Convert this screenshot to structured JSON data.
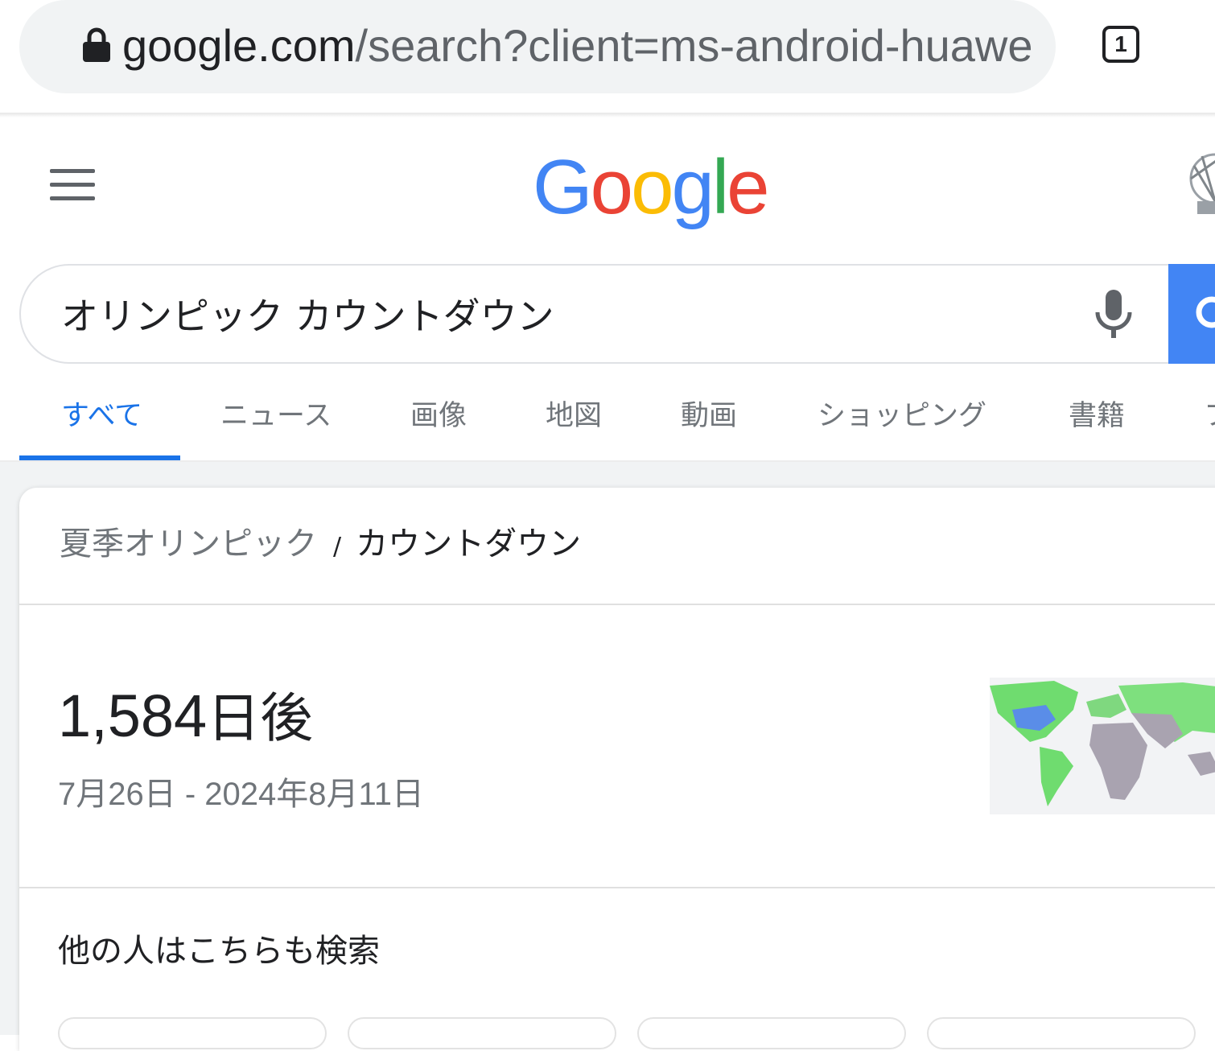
{
  "browser": {
    "url_host": "google.com",
    "url_path": "/search?client=ms-android-huawei-",
    "tab_count": "1"
  },
  "header": {
    "logo": [
      "G",
      "o",
      "o",
      "g",
      "l",
      "e"
    ],
    "logo_colors": [
      "#4285f4",
      "#ea4335",
      "#fbbc05",
      "#4285f4",
      "#34a853",
      "#ea4335"
    ]
  },
  "search": {
    "query": "オリンピック カウントダウン",
    "accent": "#4285f4"
  },
  "tabs": [
    {
      "label": "すべて",
      "active": true
    },
    {
      "label": "ニュース"
    },
    {
      "label": "画像"
    },
    {
      "label": "地図"
    },
    {
      "label": "動画"
    },
    {
      "label": "ショッピング"
    },
    {
      "label": "書籍"
    },
    {
      "label": "フ"
    }
  ],
  "result": {
    "breadcrumb_parent": "夏季オリンピック",
    "breadcrumb_sep": "/",
    "breadcrumb_current": "カウントダウン",
    "count_number": "1,584",
    "count_suffix": "日後",
    "dates": "7月26日 - 2024年8月11日",
    "also_searched": "他の人はこちらも検索"
  }
}
